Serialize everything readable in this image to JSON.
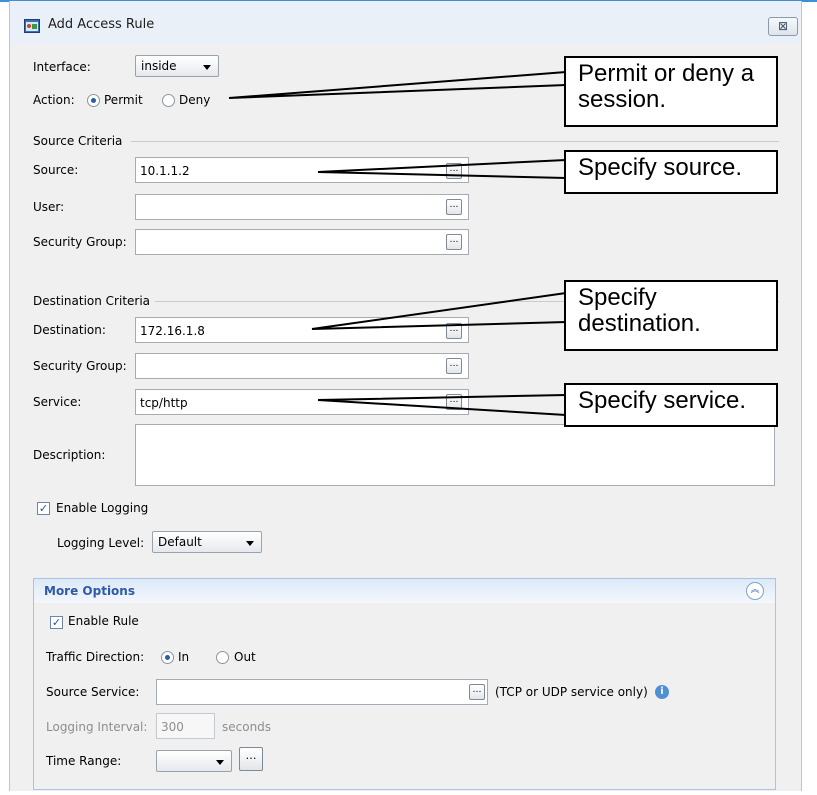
{
  "window": {
    "title": "Add Access Rule",
    "close_label": "⊠"
  },
  "interface": {
    "label": "Interface:",
    "value": "inside"
  },
  "action": {
    "label": "Action:",
    "permit": "Permit",
    "deny": "Deny",
    "selected": "Permit"
  },
  "source_criteria": {
    "heading": "Source Criteria",
    "source_label": "Source:",
    "source_value": "10.1.1.2",
    "user_label": "User:",
    "user_value": "",
    "sg_label": "Security Group:",
    "sg_value": ""
  },
  "destination_criteria": {
    "heading": "Destination Criteria",
    "destination_label": "Destination:",
    "destination_value": "172.16.1.8",
    "sg_label": "Security Group:",
    "sg_value": "",
    "service_label": "Service:",
    "service_value": "tcp/http"
  },
  "description": {
    "label": "Description:",
    "value": ""
  },
  "logging": {
    "enable_label": "Enable Logging",
    "enabled": true,
    "level_label": "Logging Level:",
    "level_value": "Default"
  },
  "more_options": {
    "title": "More Options",
    "enable_rule_label": "Enable Rule",
    "traffic_label": "Traffic Direction:",
    "in_label": "In",
    "out_label": "Out",
    "source_service_label": "Source Service:",
    "source_service_value": "",
    "source_service_note": "(TCP or UDP service only)",
    "logging_interval_label": "Logging Interval:",
    "logging_interval_value": "300",
    "logging_interval_unit": "seconds",
    "time_range_label": "Time Range:"
  },
  "callouts": {
    "action": "Permit or deny a session.",
    "source": "Specify source.",
    "destination": "Specify destination.",
    "service": "Specify service."
  },
  "icons": {
    "window": "asdm-window-icon",
    "browse": "ellipsis-icon",
    "info": "info-icon",
    "collapse": "chevrons-up-icon"
  },
  "colors": {
    "title_bar": "#e9f0f8",
    "accent": "#2f5aa8",
    "callout_border": "#000000"
  }
}
